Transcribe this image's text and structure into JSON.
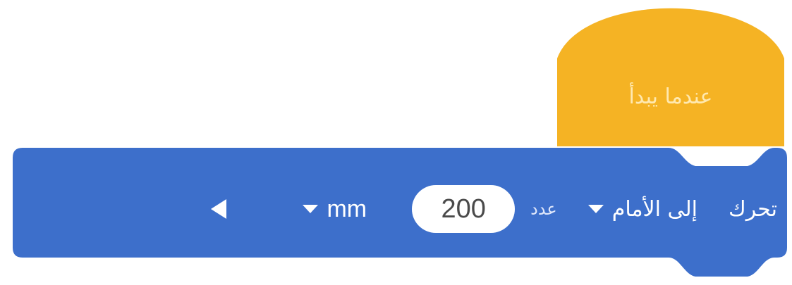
{
  "hat_block": {
    "label": "عندما يبدأ",
    "color": "#f5b324"
  },
  "move_block": {
    "color": "#3d6fcb",
    "command_label": "تحرك",
    "direction_value": "إلى الأمام",
    "amount_label": "عدد",
    "amount_value": "200",
    "unit_value": "mm"
  },
  "icons": {
    "direction_dropdown": "chevron-down-icon",
    "unit_dropdown": "chevron-down-icon",
    "collapse": "triangle-left-icon"
  }
}
